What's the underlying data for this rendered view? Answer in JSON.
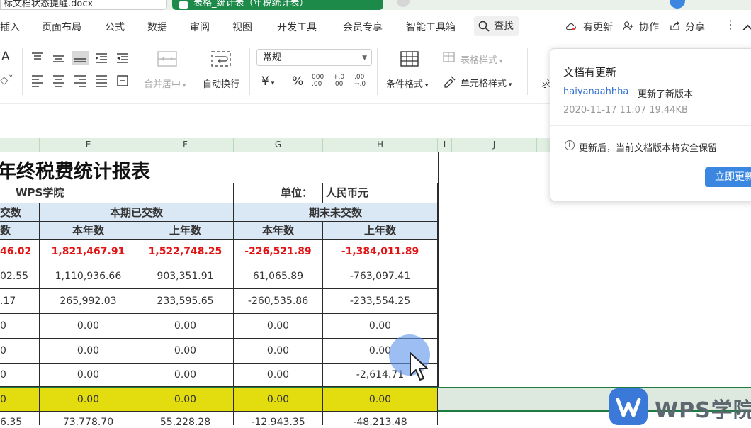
{
  "tabs": {
    "doc_tab": "标文档状态提醒.docx",
    "sheet_tab": "表格_统计表（年税统计表）"
  },
  "menu": {
    "items": [
      "插入",
      "页面布局",
      "公式",
      "数据",
      "审阅",
      "视图",
      "开发工具",
      "会员专享",
      "智能工具箱"
    ],
    "search": "查找",
    "update": "有更新",
    "collab": "协作",
    "share": "分享"
  },
  "ribbon": {
    "merge_center": "合并居中",
    "wrap_text": "自动换行",
    "number_format": "常规",
    "currency_symbol": "¥",
    "percent_symbol": "%",
    "cond_format": "条件格式",
    "table_style": "表格样式",
    "cell_style": "单元格样式",
    "sum_partial": "求"
  },
  "columns": [
    "E",
    "F",
    "G",
    "H",
    "I",
    "J"
  ],
  "sheet": {
    "title": "年终税费统计报表",
    "org": "WPS学院",
    "unit_label": "单位：",
    "unit_value": "人民币元",
    "group1": "交数",
    "group2": "本期已交数",
    "group3": "期末未交数",
    "sub": [
      "数",
      "本年数",
      "上年数",
      "本年数",
      "上年数"
    ],
    "rows": [
      [
        "46.02",
        "1,821,467.91",
        "1,522,748.25",
        "-226,521.89",
        "-1,384,011.89"
      ],
      [
        "02.55",
        "1,110,936.66",
        "903,351.91",
        "61,065.89",
        "-763,097.41"
      ],
      [
        ".17",
        "265,992.03",
        "233,595.65",
        "-260,535.86",
        "-233,554.25"
      ],
      [
        "0",
        "0.00",
        "0.00",
        "0.00",
        "0.00"
      ],
      [
        "0",
        "0.00",
        "0.00",
        "0.00",
        "0.00"
      ],
      [
        "0",
        "0.00",
        "0.00",
        "0.00",
        "-2,614.71"
      ],
      [
        "0",
        "0.00",
        "0.00",
        "0.00",
        "0.00"
      ],
      [
        "6.35",
        "73,778.70",
        "55,228.28",
        "-12,943.35",
        "-48,213.48"
      ]
    ]
  },
  "popup": {
    "title": "文档有更新",
    "user": "haiyanaahhha",
    "message": "更新了新版本",
    "meta": "2020-11-17 11:07 19.44KB",
    "note": "更新后，当前文档版本将安全保留",
    "button": "立即更新"
  },
  "watermark": "WPS学院",
  "colors": {
    "accent_green": "#1e8a4a",
    "accent_blue": "#3a86e0",
    "header_fill": "#dae7f4",
    "highlight_yellow": "#e3dd10",
    "negative_red": "#e21212"
  }
}
